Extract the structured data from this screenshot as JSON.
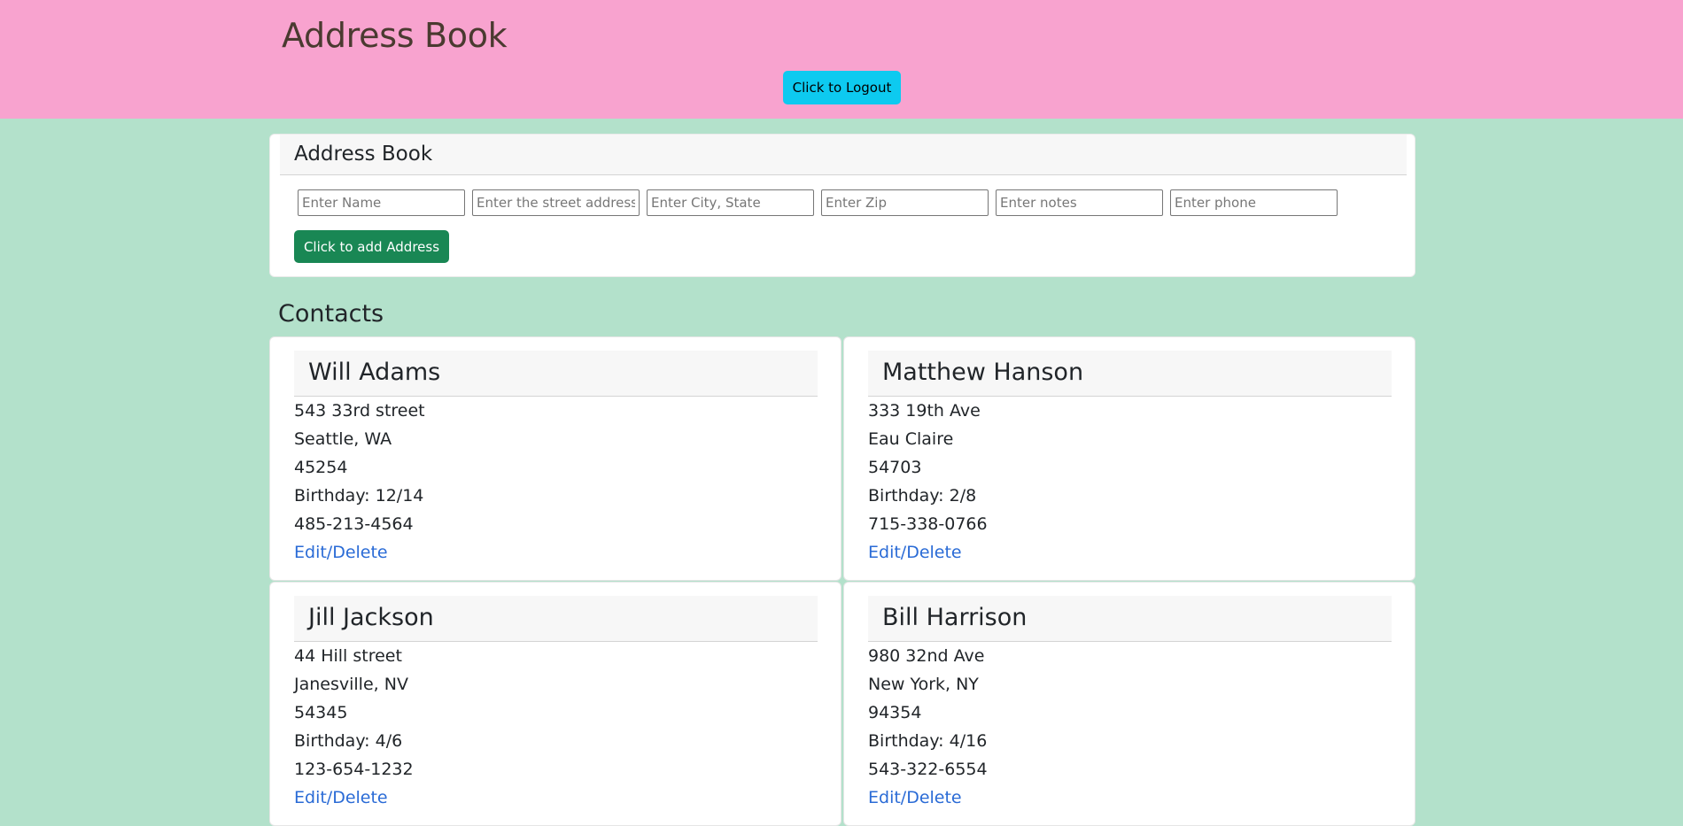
{
  "header": {
    "title": "Address Book",
    "logout_label": "Click to Logout"
  },
  "colors": {
    "header_bg": "#f8a3cf",
    "page_bg": "#b3e1cb",
    "logout_button": "#0dcaf0",
    "add_button": "#198754",
    "link": "#2a6bd6"
  },
  "form": {
    "title": "Address Book",
    "inputs": {
      "name": {
        "placeholder": "Enter Name",
        "value": ""
      },
      "street": {
        "placeholder": "Enter the street address",
        "value": ""
      },
      "city": {
        "placeholder": "Enter City, State",
        "value": ""
      },
      "zip": {
        "placeholder": "Enter Zip",
        "value": ""
      },
      "notes": {
        "placeholder": "Enter notes",
        "value": ""
      },
      "phone": {
        "placeholder": "Enter phone",
        "value": ""
      }
    },
    "add_label": "Click to add Address"
  },
  "contacts": {
    "heading": "Contacts",
    "items": [
      {
        "name": "Will Adams",
        "street": "543 33rd street",
        "city": "Seattle, WA",
        "zip": "45254",
        "birthday": "Birthday: 12/14",
        "phone": "485-213-4564",
        "link": "Edit/Delete"
      },
      {
        "name": "Matthew Hanson",
        "street": "333 19th Ave",
        "city": "Eau Claire",
        "zip": "54703",
        "birthday": "Birthday: 2/8",
        "phone": "715-338-0766",
        "link": "Edit/Delete"
      },
      {
        "name": "Jill Jackson",
        "street": "44 Hill street",
        "city": "Janesville, NV",
        "zip": "54345",
        "birthday": "Birthday: 4/6",
        "phone": "123-654-1232",
        "link": "Edit/Delete"
      },
      {
        "name": "Bill Harrison",
        "street": "980 32nd Ave",
        "city": "New York, NY",
        "zip": "94354",
        "birthday": "Birthday: 4/16",
        "phone": "543-322-6554",
        "link": "Edit/Delete"
      }
    ]
  }
}
